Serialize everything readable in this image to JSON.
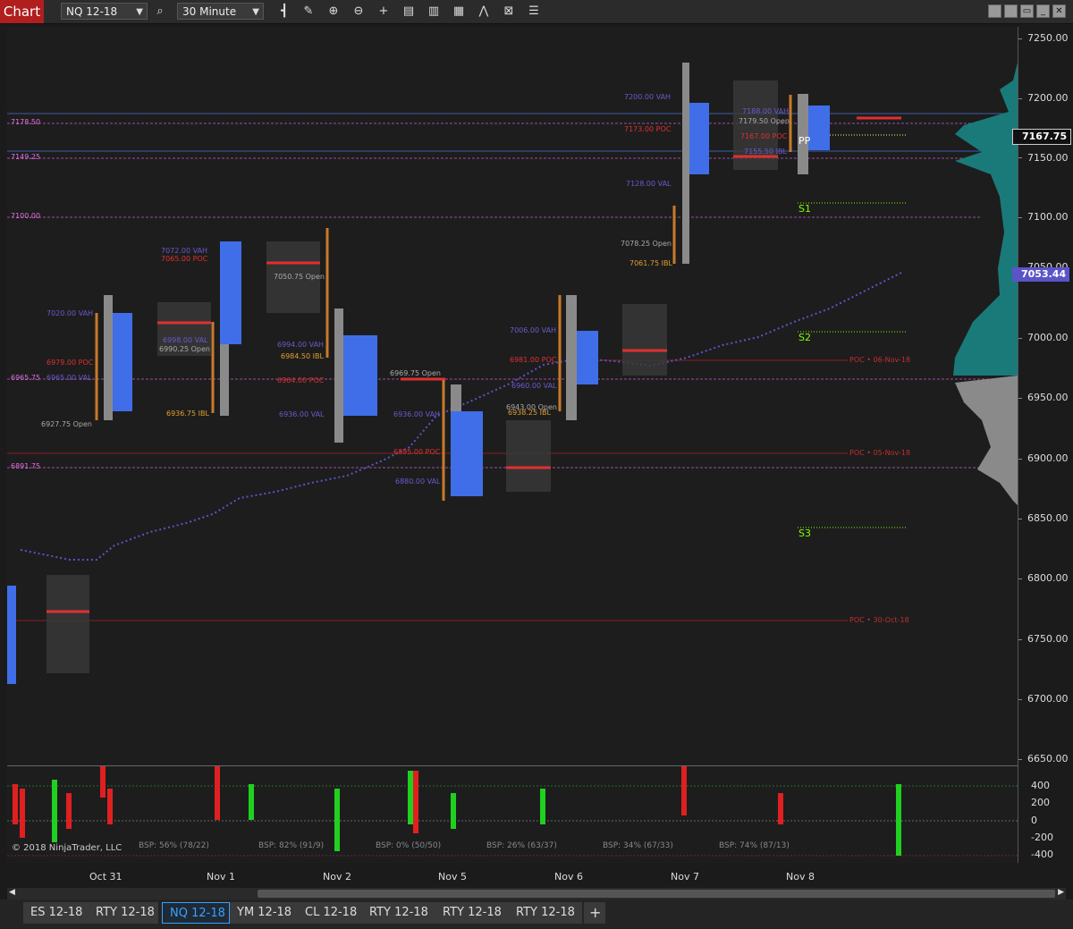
{
  "toolbar": {
    "chart_label": "Chart",
    "instrument": "NQ 12-18",
    "interval": "30 Minute",
    "icons": [
      "search-icon",
      "bar-type-icon",
      "drawing-tool-icon",
      "zoom-in-icon",
      "zoom-out-icon",
      "crosshair-icon",
      "properties-icon",
      "templates-icon",
      "strategies-icon",
      "indicators-icon",
      "snapshot-icon",
      "menu-icon"
    ],
    "window_buttons": [
      "minimize-icon",
      "restore-icon",
      "maximize-icon",
      "close-icon"
    ]
  },
  "price_axis": {
    "labels": [
      "7250.00",
      "7200.00",
      "7150.00",
      "7100.00",
      "7050.00",
      "7000.00",
      "6950.00",
      "6900.00",
      "6850.00",
      "6800.00",
      "6750.00",
      "6700.00",
      "6650.00"
    ],
    "current_price": "7167.75",
    "ma_price": "7053.44"
  },
  "sub_axis": {
    "labels": [
      "400",
      "200",
      "0",
      "-200",
      "-400"
    ]
  },
  "dates": [
    "Oct 31",
    "Nov 1",
    "Nov 2",
    "Nov 5",
    "Nov 6",
    "Nov 7",
    "Nov 8"
  ],
  "copyright": "© 2018 NinjaTrader, LLC",
  "bsp": [
    "BSP: 56% (78/22)",
    "BSP: 82% (91/9)",
    "BSP: 0% (50/50)",
    "BSP: 26% (63/37)",
    "BSP: 34% (67/33)",
    "BSP: 74% (87/13)"
  ],
  "level_labels": {
    "l7178": "7178.50",
    "l7149": "7149.25",
    "l7100": "7100.00",
    "l6965": "6965.75",
    "l6891": "6891.75"
  },
  "profile_labels": {
    "a1": "7020.00 VAH",
    "a2": "6979.00 POC",
    "a3": "6965.00 VAL",
    "a4": "6927.75 Open",
    "b1": "6998.00 VAL",
    "b2": "6990.25 Open",
    "b3": "6936.75 IBL",
    "c1": "7072.00 VAH",
    "c2": "7065.00 POC",
    "d1": "7050.75 Open",
    "d2": "6994.00 VAH",
    "d3": "6984.50 IBL",
    "d4": "6964.00 POC",
    "d5": "6936.00 VAL",
    "e1": "6969.75 Open",
    "e2": "6936.00 VAH",
    "e3": "6895.00 POC",
    "e4": "6880.00 VAL",
    "f1": "7006.00 VAH",
    "f2": "6981.00 POC",
    "f3": "6960.00 VAL",
    "f4": "6943.00 Open",
    "f5": "6938.25 IBL",
    "g1": "7200.00 VAH",
    "g2": "7173.00 POC",
    "g3": "7128.00 VAL",
    "g4": "7078.25 Open",
    "g5": "7061.75 IBL",
    "h1": "7188.00 VAH",
    "h2": "7179.50 Open",
    "h3": "7167.00 POC",
    "h4": "7155.50 IBL"
  },
  "pivots": {
    "pp": "PP",
    "s1": "S1",
    "s2": "S2",
    "s3": "S3"
  },
  "naked_poc": {
    "n1": "POC • 06-Nov-18",
    "n2": "POC • 05-Nov-18",
    "n3": "POC • 30-Oct-18"
  },
  "instrument_tabs": [
    "ES 12-18",
    "RTY 12-18",
    "NQ 12-18",
    "YM 12-18",
    "CL 12-18",
    "RTY 12-18",
    "RTY 12-18",
    "RTY 12-18"
  ],
  "add_tab": "+",
  "colors": {
    "accent": "#b01e1e",
    "profile": "#3f6ee8",
    "poc": "#e03030",
    "vah": "#6a5acd",
    "pivot": "#7fff00",
    "teal": "#1a8a8a",
    "ma": "#5a54c8"
  }
}
